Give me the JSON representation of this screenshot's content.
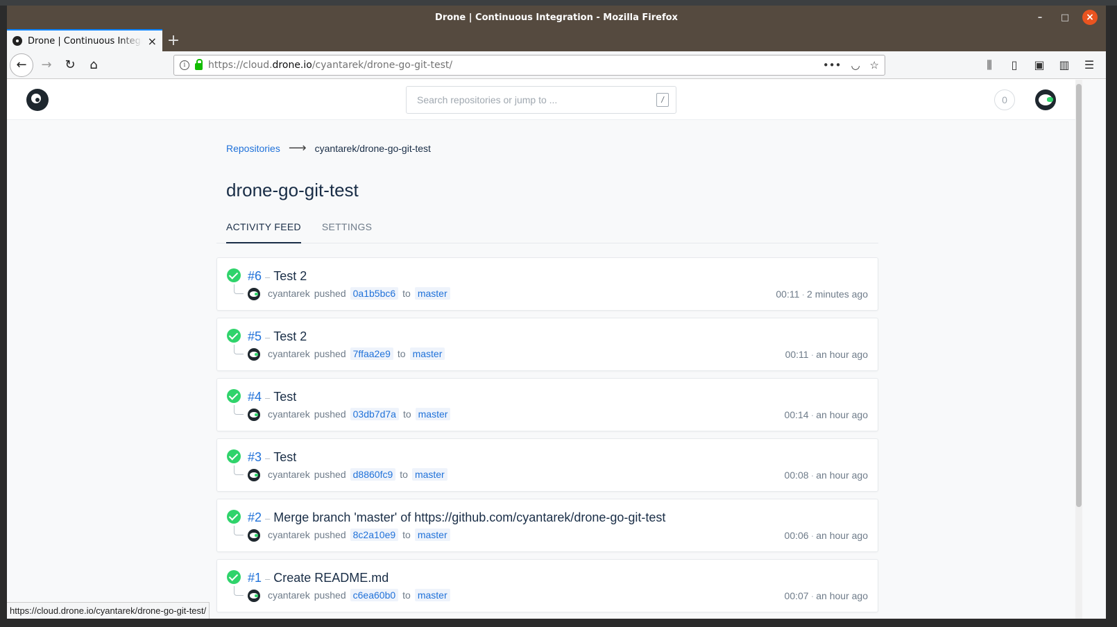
{
  "window": {
    "title": "Drone | Continuous Integration - Mozilla Firefox"
  },
  "browser": {
    "tab_title": "Drone | Continuous Integration",
    "url_scheme_prefix": "https://cloud.",
    "url_host": "drone.io",
    "url_path": "/cyantarek/drone-go-git-test/",
    "status_url": "https://cloud.drone.io/cyantarek/drone-go-git-test/"
  },
  "header": {
    "search_placeholder": "Search repositories or jump to ...",
    "search_shortcut": "/",
    "notification_count": "0"
  },
  "breadcrumb": {
    "root": "Repositories",
    "current": "cyantarek/drone-go-git-test"
  },
  "repo": {
    "title": "drone-go-git-test"
  },
  "tabs": [
    {
      "label": "ACTIVITY FEED",
      "active": true
    },
    {
      "label": "SETTINGS",
      "active": false
    }
  ],
  "builds": [
    {
      "number": "#6",
      "message": "Test 2",
      "author": "cyantarek",
      "action": "pushed",
      "commit": "0a1b5bc6",
      "to": "to",
      "branch": "master",
      "duration": "00:11",
      "when": "2 minutes ago",
      "status": "success"
    },
    {
      "number": "#5",
      "message": "Test 2",
      "author": "cyantarek",
      "action": "pushed",
      "commit": "7ffaa2e9",
      "to": "to",
      "branch": "master",
      "duration": "00:11",
      "when": "an hour ago",
      "status": "success"
    },
    {
      "number": "#4",
      "message": "Test",
      "author": "cyantarek",
      "action": "pushed",
      "commit": "03db7d7a",
      "to": "to",
      "branch": "master",
      "duration": "00:14",
      "when": "an hour ago",
      "status": "success"
    },
    {
      "number": "#3",
      "message": "Test",
      "author": "cyantarek",
      "action": "pushed",
      "commit": "d8860fc9",
      "to": "to",
      "branch": "master",
      "duration": "00:08",
      "when": "an hour ago",
      "status": "success"
    },
    {
      "number": "#2",
      "message": "Merge branch 'master' of https://github.com/cyantarek/drone-go-git-test",
      "author": "cyantarek",
      "action": "pushed",
      "commit": "8c2a10e9",
      "to": "to",
      "branch": "master",
      "duration": "00:06",
      "when": "an hour ago",
      "status": "success"
    },
    {
      "number": "#1",
      "message": "Create README.md",
      "author": "cyantarek",
      "action": "pushed",
      "commit": "c6ea60b0",
      "to": "to",
      "branch": "master",
      "duration": "00:07",
      "when": "an hour ago",
      "status": "success"
    }
  ],
  "separators": {
    "dash": "–",
    "dot": "·"
  },
  "icons": {
    "back": "arrow-left-icon",
    "forward": "arrow-right-icon",
    "reload": "reload-icon",
    "home": "home-icon",
    "page_actions": "ellipsis-icon",
    "pocket": "pocket-icon",
    "bookmark": "star-icon",
    "library": "library-icon",
    "sidebar": "sidebar-icon",
    "extension": "extension-icon",
    "reader": "reader-icon",
    "menu": "hamburger-menu-icon"
  },
  "colors": {
    "accent": "#1f71d9",
    "success": "#2fd36b",
    "titlebar": "#554a3f",
    "close_button": "#e95420"
  }
}
